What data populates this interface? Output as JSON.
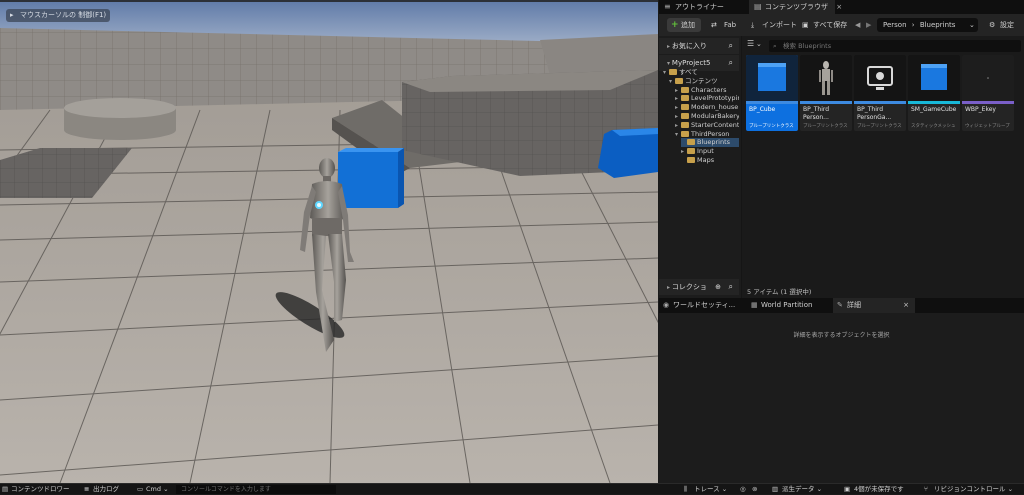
{
  "viewport": {
    "hint": "マウスカーソルの 制御(F1)",
    "hint_icon": "mouse-icon"
  },
  "tabs": {
    "outliner": "アウトライナー",
    "content_browser": "コンテンツブラウザ",
    "close": "×"
  },
  "toolbar": {
    "add": "追加",
    "fab": "Fab",
    "import": "インポート",
    "save_all": "すべて保存",
    "crumb_root": "Person",
    "crumb_sep": "›",
    "crumb_leaf": "Blueprints",
    "settings": "設定"
  },
  "sidebar": {
    "favorites": "お気に入り",
    "project": "MyProject5",
    "collections": "コレクショ"
  },
  "tree": [
    {
      "label": "すべて",
      "level": 0,
      "caret": "▾"
    },
    {
      "label": "コンテンツ",
      "level": 1,
      "caret": "▾"
    },
    {
      "label": "Characters",
      "level": 2,
      "caret": "▸"
    },
    {
      "label": "LevelPrototyping",
      "level": 2,
      "caret": "▸"
    },
    {
      "label": "Modern_house",
      "level": 2,
      "caret": "▸"
    },
    {
      "label": "ModularBakery",
      "level": 2,
      "caret": "▸"
    },
    {
      "label": "StarterContent",
      "level": 2,
      "caret": "▸"
    },
    {
      "label": "ThirdPerson",
      "level": 2,
      "caret": "▾"
    },
    {
      "label": "Blueprints",
      "level": 3,
      "caret": ""
    },
    {
      "label": "Input",
      "level": 3,
      "caret": "▸"
    },
    {
      "label": "Maps",
      "level": 3,
      "caret": ""
    }
  ],
  "search": {
    "placeholder": "検索 Blueprints"
  },
  "assets": [
    {
      "name": "BP_Cube",
      "class": "ブループリントクラス",
      "bar": "#3d8ae0",
      "selected": true
    },
    {
      "name": "BP_Third\nPerson...",
      "class": "ブループリントクラス",
      "bar": "#3d8ae0",
      "selected": false
    },
    {
      "name": "BP_Third\nPersonGa...",
      "class": "ブループリントクラス",
      "bar": "#3d8ae0",
      "selected": false
    },
    {
      "name": "SM_GameCube",
      "class": "スタティックメッシュ",
      "bar": "#18b8d8",
      "selected": false
    },
    {
      "name": "WBP_Ekey",
      "class": "ウィジェットブループ",
      "bar": "#7a5fc8",
      "selected": false
    }
  ],
  "status": "5 アイテム (1 選択中)",
  "details": {
    "tab_world": "ワールドセッティ...",
    "tab_partition": "World Partition",
    "tab_details": "詳細",
    "close": "×",
    "message": "詳細を表示するオブジェクトを選択"
  },
  "bottom": {
    "drawer": "コンテンツドロワー",
    "output_log": "出力ログ",
    "cmd": "Cmd",
    "cmd_placeholder": "コンソールコマンドを入力します",
    "trace": "トレース",
    "derived": "派生データ",
    "unsaved": "4個が未保存です",
    "revision": "リビジョンコントロール"
  },
  "colors": {
    "accent": "#0d70e0",
    "cube": "#1270d6",
    "add_plus": "#63c23b",
    "folder": "#c7a04b"
  }
}
